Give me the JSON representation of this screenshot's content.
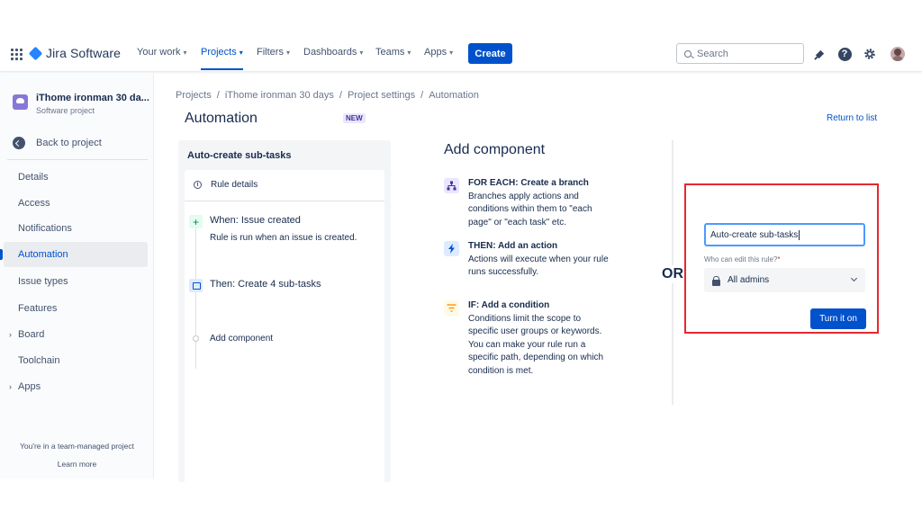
{
  "topnav": {
    "app_name": "Jira Software",
    "items": [
      {
        "label": "Your work"
      },
      {
        "label": "Projects"
      },
      {
        "label": "Filters"
      },
      {
        "label": "Dashboards"
      },
      {
        "label": "Teams"
      },
      {
        "label": "Apps"
      }
    ],
    "active_item": "Projects",
    "create_label": "Create",
    "search_placeholder": "Search"
  },
  "sidebar": {
    "project_name": "iThome ironman 30 da...",
    "project_type": "Software project",
    "back_label": "Back to project",
    "items": [
      {
        "label": "Details"
      },
      {
        "label": "Access"
      },
      {
        "label": "Notifications"
      },
      {
        "label": "Automation"
      },
      {
        "label": "Issue types"
      },
      {
        "label": "Features"
      },
      {
        "label": "Board"
      },
      {
        "label": "Toolchain"
      },
      {
        "label": "Apps"
      }
    ],
    "selected_item": "Automation",
    "team_note": "You're in a team-managed project",
    "learn_more": "Learn more"
  },
  "breadcrumb": [
    "Projects",
    "/",
    "iThome ironman 30 days",
    "/",
    "Project settings",
    "/",
    "Automation"
  ],
  "page": {
    "title": "Automation",
    "badge": "NEW",
    "return_link": "Return to list"
  },
  "rule": {
    "title": "Auto-create sub-tasks",
    "details_label": "Rule details",
    "when_label": "When: Issue created",
    "when_desc": "Rule is run when an issue is created.",
    "then_label": "Then: Create 4 sub-tasks",
    "add_label": "Add component"
  },
  "add_component": {
    "title": "Add component",
    "components": [
      {
        "heading": "FOR EACH: Create a branch",
        "desc": "Branches apply actions and conditions within them to \"each page\" or \"each task\" etc.",
        "icon": "branch-icon"
      },
      {
        "heading": "THEN: Add an action",
        "desc": "Actions will execute when your rule runs successfully.",
        "icon": "lightning-icon"
      },
      {
        "heading": "IF: Add a condition",
        "desc": "Conditions limit the scope to specific user groups or keywords. You can make your rule run a specific path, depending on which condition is met.",
        "icon": "filter-icon"
      }
    ],
    "or_label": "OR"
  },
  "turn_on_form": {
    "name_value": "Auto-create sub-tasks",
    "edit_label": "Who can edit this rule?",
    "required_mark": "*",
    "editor_value": "All admins",
    "button_label": "Turn it on",
    "highlight_color": "#e5282e"
  },
  "colors": {
    "brand": "#0052cc",
    "text": "#172b4d",
    "sidebar_bg": "#fafbfc"
  }
}
